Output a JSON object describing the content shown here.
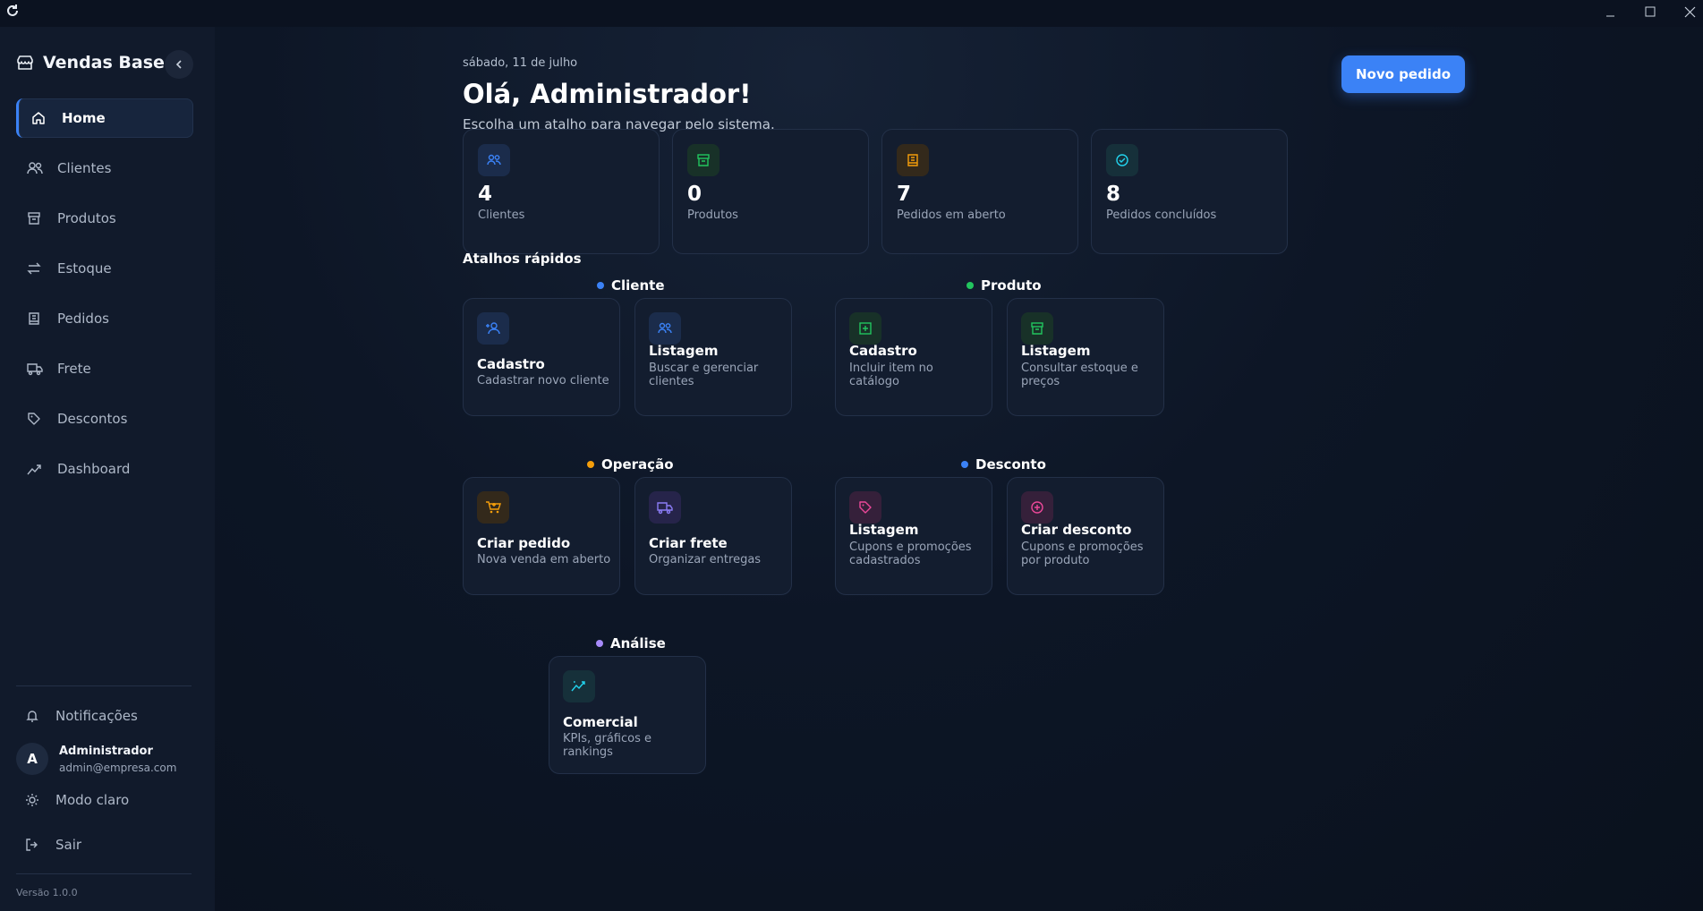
{
  "app": {
    "title": "Vendas Base"
  },
  "sidebar": {
    "items": [
      {
        "label": "Home",
        "icon": "home-icon",
        "active": true
      },
      {
        "label": "Clientes",
        "icon": "users-icon"
      },
      {
        "label": "Produtos",
        "icon": "archive-icon"
      },
      {
        "label": "Estoque",
        "icon": "arrows-icon"
      },
      {
        "label": "Pedidos",
        "icon": "receipt-icon"
      },
      {
        "label": "Frete",
        "icon": "truck-icon"
      },
      {
        "label": "Descontos",
        "icon": "tag-icon"
      },
      {
        "label": "Dashboard",
        "icon": "trend-icon"
      }
    ],
    "notifications_label": "Notificações",
    "user": {
      "initial": "A",
      "name": "Administrador",
      "email": "admin@empresa.com"
    },
    "theme_label": "Modo claro",
    "logout_label": "Sair",
    "version": "Versão 1.0.0"
  },
  "header": {
    "date": "sábado, 11 de julho",
    "greeting": "Olá, Administrador!",
    "subtitle": "Escolha um atalho para navegar pelo sistema.",
    "new_order_label": "Novo pedido"
  },
  "stats": [
    {
      "value": "4",
      "label": "Clientes",
      "color": "#3b82f6"
    },
    {
      "value": "0",
      "label": "Produtos",
      "color": "#22c55e"
    },
    {
      "value": "7",
      "label": "Pedidos em aberto",
      "color": "#f59e0b"
    },
    {
      "value": "8",
      "label": "Pedidos concluídos",
      "color": "#22d3ee"
    }
  ],
  "shortcuts": {
    "title": "Atalhos rápidos",
    "groups": {
      "cliente": {
        "label": "Cliente",
        "color": "#3b82f6",
        "cards": [
          {
            "title": "Cadastro",
            "desc": "Cadastrar novo cliente"
          },
          {
            "title": "Listagem",
            "desc": "Buscar e gerenciar clientes"
          }
        ]
      },
      "produto": {
        "label": "Produto",
        "color": "#22c55e",
        "cards": [
          {
            "title": "Cadastro",
            "desc": "Incluir item no catálogo"
          },
          {
            "title": "Listagem",
            "desc": "Consultar estoque e preços"
          }
        ]
      },
      "operacao": {
        "label": "Operação",
        "color": "#f59e0b",
        "cards": [
          {
            "title": "Criar pedido",
            "desc": "Nova venda em aberto"
          },
          {
            "title": "Criar frete",
            "desc": "Organizar entregas"
          }
        ]
      },
      "desconto": {
        "label": "Desconto",
        "color": "#3b82f6",
        "cards": [
          {
            "title": "Listagem",
            "desc": "Cupons e promoções cadastrados"
          },
          {
            "title": "Criar desconto",
            "desc": "Cupons e promoções por produto"
          }
        ]
      },
      "analise": {
        "label": "Análise",
        "color": "#a78bfa",
        "cards": [
          {
            "title": "Comercial",
            "desc": "KPIs, gráficos e rankings"
          }
        ]
      }
    }
  }
}
